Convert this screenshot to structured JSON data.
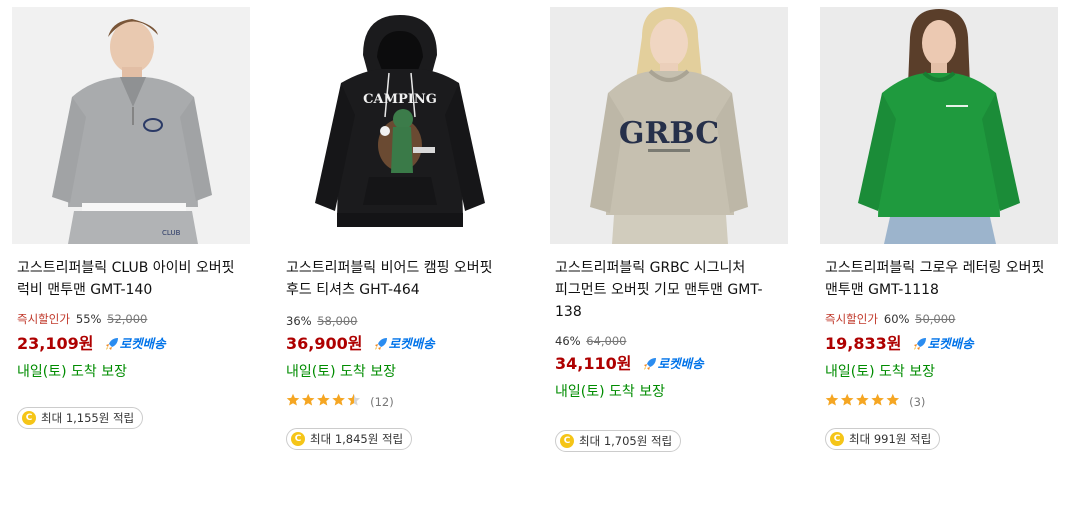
{
  "rocket_label": "로켓배송",
  "products": [
    {
      "title": "고스트리퍼블릭 CLUB 아이비 오버핏 럭비 맨투맨 GMT-140",
      "instant_label": "즉시할인가",
      "discount": "55%",
      "original_price": "52,000",
      "price": "23,109원",
      "delivery": "내일(토) 도착 보장",
      "rating": null,
      "review_count": null,
      "cashback": "최대 1,155원 적립"
    },
    {
      "title": "고스트리퍼블릭 비어드 캠핑 오버핏 후드 티셔츠 GHT-464",
      "instant_label": "",
      "discount": "36%",
      "original_price": "58,000",
      "price": "36,900원",
      "delivery": "내일(토) 도착 보장",
      "rating": 4.5,
      "review_count": "(12)",
      "cashback": "최대 1,845원 적립"
    },
    {
      "title": "고스트리퍼블릭 GRBC 시그니처 피그먼트 오버핏 기모 맨투맨 GMT-138",
      "instant_label": "",
      "discount": "46%",
      "original_price": "64,000",
      "price": "34,110원",
      "delivery": "내일(토) 도착 보장",
      "rating": null,
      "review_count": null,
      "cashback": "최대 1,705원 적립"
    },
    {
      "title": "고스트리퍼블릭 그로우 레터링 오버핏 맨투맨 GMT-1118",
      "instant_label": "즉시할인가",
      "discount": "60%",
      "original_price": "50,000",
      "price": "19,833원",
      "delivery": "내일(토) 도착 보장",
      "rating": 5,
      "review_count": "(3)",
      "cashback": "최대 991원 적립"
    }
  ],
  "image_text": {
    "camping_print": "CAMPING",
    "grbc_print": "GRBC"
  },
  "colors": {
    "price": "#ae0000",
    "instant": "#c0392b",
    "delivery": "#008c00",
    "rocket": "#0073e9",
    "star": "#f5a623",
    "coin": "#f5c518"
  }
}
